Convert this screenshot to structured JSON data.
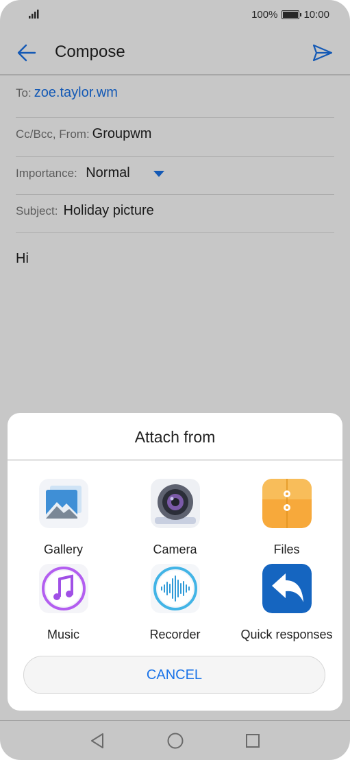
{
  "status": {
    "battery": "100%",
    "time": "10:00"
  },
  "appbar": {
    "title": "Compose"
  },
  "form": {
    "to_label": "To:",
    "to_value": "zoe.taylor.wm",
    "ccbcc_label": "Cc/Bcc, From:",
    "from_value": "Groupwm",
    "importance_label": "Importance:",
    "importance_value": "Normal",
    "subject_label": "Subject:",
    "subject_value": "Holiday picture",
    "body": "Hi"
  },
  "sheet": {
    "title": "Attach from",
    "items": [
      {
        "label": "Gallery",
        "icon": "gallery-icon"
      },
      {
        "label": "Camera",
        "icon": "camera-icon"
      },
      {
        "label": "Files",
        "icon": "files-icon"
      },
      {
        "label": "Music",
        "icon": "music-icon"
      },
      {
        "label": "Recorder",
        "icon": "recorder-icon"
      },
      {
        "label": "Quick responses",
        "icon": "quick-responses-icon"
      }
    ],
    "cancel_label": "CANCEL"
  },
  "colors": {
    "accent": "#1a73e8",
    "files": "#f7a93b",
    "quick": "#1565c0"
  }
}
